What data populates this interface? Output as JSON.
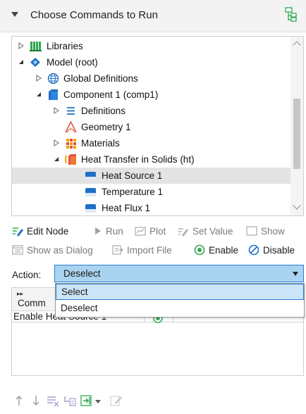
{
  "header": {
    "title": "Choose Commands to Run",
    "icon": "node-tree-icon"
  },
  "tree": {
    "items": [
      {
        "label": "Libraries",
        "icon": "libraries-icon",
        "expander": "collapsed"
      },
      {
        "label": "Model (root)",
        "icon": "model-root-icon",
        "expander": "expanded"
      },
      {
        "label": "Global Definitions",
        "icon": "globe-icon",
        "expander": "collapsed"
      },
      {
        "label": "Component 1 (comp1)",
        "icon": "component-icon",
        "expander": "expanded"
      },
      {
        "label": "Definitions",
        "icon": "definitions-icon",
        "expander": "collapsed"
      },
      {
        "label": "Geometry 1",
        "icon": "geometry-icon",
        "expander": "none"
      },
      {
        "label": "Materials",
        "icon": "materials-icon",
        "expander": "collapsed"
      },
      {
        "label": "Heat Transfer in Solids (ht)",
        "icon": "heat-transfer-icon",
        "expander": "expanded"
      },
      {
        "label": "Heat Source 1",
        "icon": "boundary-feature-icon",
        "expander": "none",
        "selected": true
      },
      {
        "label": "Temperature 1",
        "icon": "boundary-feature-icon",
        "expander": "none"
      },
      {
        "label": "Heat Flux 1",
        "icon": "boundary-feature-icon",
        "expander": "none"
      }
    ]
  },
  "toolbar": {
    "edit_node": "Edit Node",
    "run": "Run",
    "plot": "Plot",
    "set_value": "Set Value",
    "show": "Show",
    "show_as_dialog": "Show as Dialog",
    "import_file": "Import File",
    "enable": "Enable",
    "disable": "Disable"
  },
  "action": {
    "label": "Action:",
    "value": "Deselect",
    "options": [
      "Select",
      "Deselect"
    ],
    "highlighted": "Select"
  },
  "command_list": {
    "header": "Command",
    "header_visible": "Comm",
    "rows": [
      {
        "command": "Enable Heat Source 1",
        "status": "enabled"
      }
    ]
  },
  "bottom_toolbar": [
    "move-up-icon",
    "move-down-icon",
    "clear-list-icon",
    "add-to-list-icon",
    "insert-command-icon",
    "edit-icon"
  ],
  "colors": {
    "accent": "#2b7cd3",
    "selection": "#e3e3e3",
    "combo_bg": "#a9d3f0",
    "enable_green": "#2fa84f",
    "disable_blue": "#1f6fc5"
  }
}
